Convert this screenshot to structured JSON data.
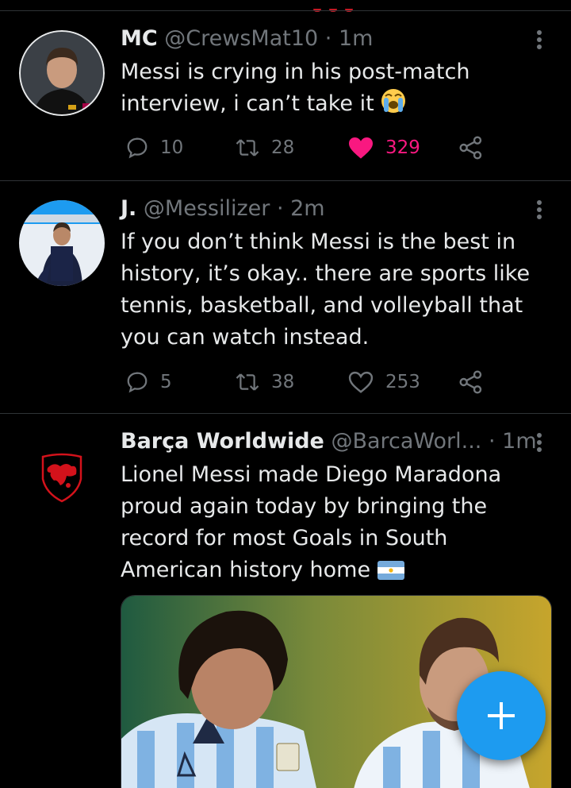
{
  "tweets": [
    {
      "name": "MC",
      "handle": "@CrewsMat10",
      "time": "· 1m",
      "text": "Messi is crying in his post-match interview, i can’t take it",
      "emoji": "loudly-crying-face",
      "replies": "10",
      "retweets": "28",
      "likes": "329",
      "liked": true
    },
    {
      "name": "J.",
      "handle": "@Messilizer",
      "time": "· 2m",
      "text": "If you don’t think Messi is the best in history, it’s okay.. there are sports like tennis, basketball, and volleyball that you can watch instead.",
      "replies": "5",
      "retweets": "38",
      "likes": "253",
      "liked": false
    },
    {
      "name": "Barça Worldwide",
      "handle": "@BarcaWorl...",
      "time": "· 1m",
      "text": "Lionel Messi made Diego Maradona proud again today by bringing the record for most Goals in South American history home",
      "emoji": "flag-argentina"
    }
  ],
  "colors": {
    "background": "#000000",
    "text": "#e7e9ea",
    "secondary": "#71767b",
    "like": "#f91880",
    "accent": "#1d9bf0",
    "divider": "#2f3336"
  },
  "compose": {
    "icon": "plus-icon"
  }
}
